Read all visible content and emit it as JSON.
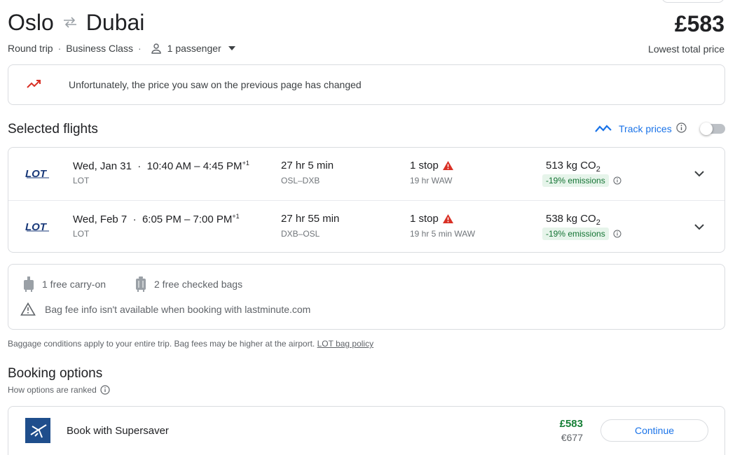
{
  "trip": {
    "origin": "Oslo",
    "destination": "Dubai",
    "total_price": "£583",
    "trip_type": "Round trip",
    "cabin_class": "Business Class",
    "passengers": "1 passenger",
    "price_caption": "Lowest total price"
  },
  "notice": {
    "message": "Unfortunately, the price you saw on the previous page has changed"
  },
  "selected_flights": {
    "title": "Selected flights",
    "track_label": "Track prices",
    "track_enabled": false,
    "flights": [
      {
        "date": "Wed, Jan 31",
        "times": "10:40 AM – 4:45 PM",
        "day_offset": "+1",
        "airline": "LOT",
        "duration": "27 hr 5 min",
        "route": "OSL–DXB",
        "stops": "1 stop",
        "layover": "19 hr WAW",
        "co2": "513 kg CO",
        "emissions": "-19% emissions"
      },
      {
        "date": "Wed, Feb 7",
        "times": "6:05 PM – 7:00 PM",
        "day_offset": "+1",
        "airline": "LOT",
        "duration": "27 hr 55 min",
        "route": "DXB–OSL",
        "stops": "1 stop",
        "layover": "19 hr 5 min WAW",
        "co2": "538 kg CO",
        "emissions": "-19% emissions"
      }
    ]
  },
  "baggage": {
    "carry_on": "1 free carry-on",
    "checked": "2 free checked bags",
    "fee_warning": "Bag fee info isn't available when booking with lastminute.com",
    "note": "Baggage conditions apply to your entire trip. Bag fees may be higher at the airport.",
    "policy_link": "LOT bag policy"
  },
  "booking": {
    "title": "Booking options",
    "ranked_label": "How options are ranked",
    "options": [
      {
        "provider": "Book with Supersaver",
        "price": "£583",
        "alt_price": "€677",
        "button": "Continue"
      }
    ]
  },
  "colors": {
    "accent": "#1a73e8",
    "price_green": "#188038",
    "warning_red": "#d93025",
    "eco_badge_bg": "#e6f4ea",
    "lot_blue": "#1a3a7a"
  },
  "icons": {
    "swap": "swap-arrows-icon",
    "passenger": "person-icon",
    "dropdown": "caret-down-icon",
    "price_change": "trending-up-icon",
    "track": "trend-line-icon",
    "info": "info-icon",
    "warning": "warning-triangle-icon",
    "expand": "chevron-down-icon",
    "carry_on": "carry-on-bag-icon",
    "checked_bag": "suitcase-icon"
  }
}
